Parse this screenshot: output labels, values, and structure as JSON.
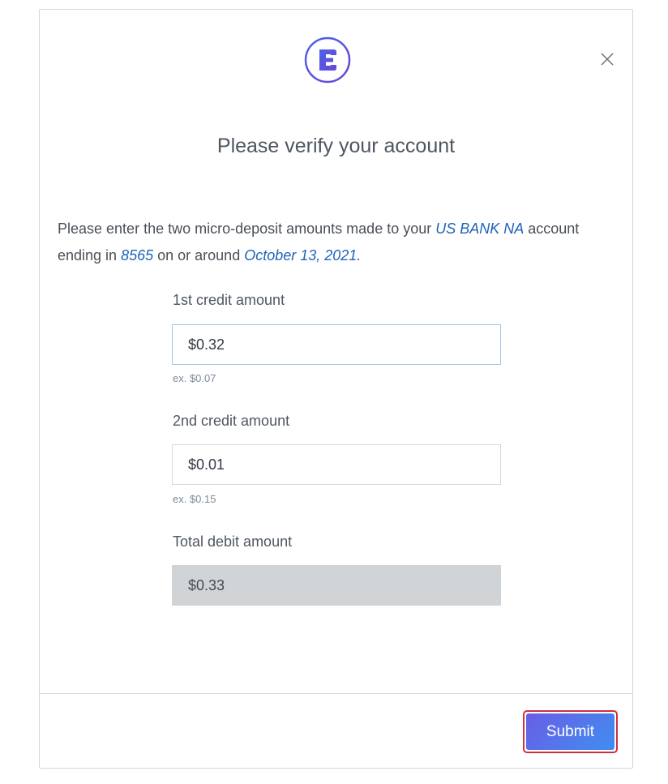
{
  "dialog": {
    "logo_icon": "e-brand-logo-icon",
    "close_icon": "close-icon",
    "title": "Please verify your account"
  },
  "intro": {
    "part1": "Please enter the two micro-deposit amounts made to your ",
    "bank_name": "US BANK NA",
    "part2": " account ending in ",
    "account_last4": "8565",
    "part3": " on or around ",
    "date": "October 13, 2021."
  },
  "fields": {
    "credit1": {
      "label": "1st credit amount",
      "value": "$0.32",
      "hint": "ex. $0.07"
    },
    "credit2": {
      "label": "2nd credit amount",
      "value": "$0.01",
      "hint": "ex. $0.15"
    },
    "debit_total": {
      "label": "Total debit amount",
      "value": "$0.33"
    }
  },
  "footer": {
    "submit_label": "Submit"
  },
  "colors": {
    "accent": "#4f5ee6",
    "link": "#1e63b8",
    "highlight_border": "#d0303c"
  }
}
